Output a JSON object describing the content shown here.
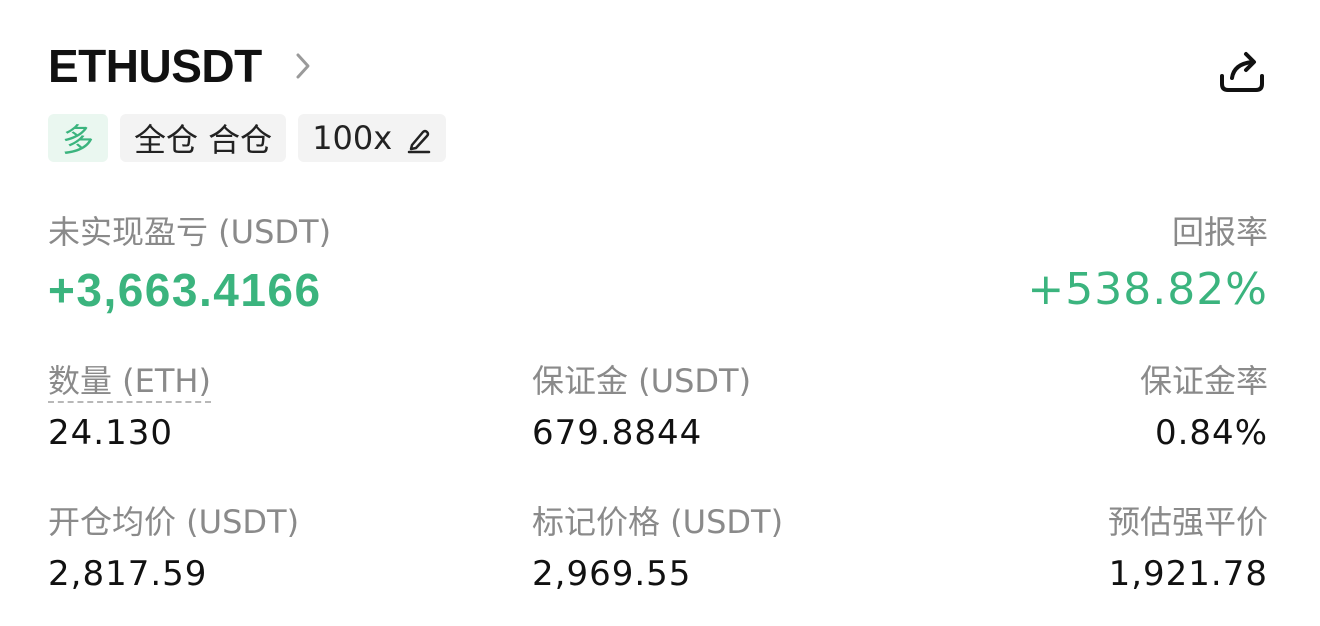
{
  "header": {
    "symbol": "ETHUSDT",
    "chevron_icon": "chevron-right-icon",
    "share_icon": "share-icon"
  },
  "tags": {
    "side": "多",
    "margin_mode": "全仓 合仓",
    "leverage": "100x",
    "edit_icon": "pencil-icon"
  },
  "pnl": {
    "label": "未实现盈亏 (USDT)",
    "value": "+3,663.4166"
  },
  "roe": {
    "label": "回报率",
    "value": "+538.82%"
  },
  "stats": {
    "quantity_label": "数量 (ETH)",
    "quantity_value": "24.130",
    "margin_label": "保证金 (USDT)",
    "margin_value": "679.8844",
    "margin_ratio_label": "保证金率",
    "margin_ratio_value": "0.84%",
    "entry_label": "开仓均价 (USDT)",
    "entry_value": "2,817.59",
    "mark_label": "标记价格 (USDT)",
    "mark_value": "2,969.55",
    "liq_label": "预估强平价",
    "liq_value": "1,921.78"
  },
  "colors": {
    "profit_green": "#3bb47e",
    "long_tag_bg": "#eaf7f0",
    "label_gray": "#8a8a8a"
  }
}
